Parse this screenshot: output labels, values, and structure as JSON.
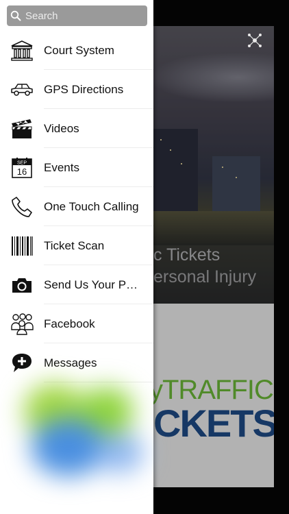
{
  "search": {
    "placeholder": "Search"
  },
  "menu": {
    "items": [
      {
        "label": "Court System",
        "icon": "courthouse-icon"
      },
      {
        "label": "GPS Directions",
        "icon": "car-icon"
      },
      {
        "label": "Videos",
        "icon": "clapperboard-icon"
      },
      {
        "label": "Events",
        "icon": "calendar-icon",
        "calendar_month": "SEP",
        "calendar_day": "16"
      },
      {
        "label": "One Touch Calling",
        "icon": "phone-icon"
      },
      {
        "label": "Ticket Scan",
        "icon": "barcode-icon"
      },
      {
        "label": "Send Us Your P…",
        "icon": "camera-icon"
      },
      {
        "label": "Facebook",
        "icon": "people-icon"
      },
      {
        "label": "Messages",
        "icon": "message-add-icon"
      }
    ]
  },
  "background": {
    "banner_line1": "c Tickets",
    "banner_line2": "ersonal Injury",
    "logo_line1": "yTRAFFIC",
    "logo_line2": "CKETS"
  },
  "colors": {
    "logo_green": "#6fbf3a",
    "logo_blue": "#1f4e8c",
    "search_bg": "#9a9a9a"
  }
}
